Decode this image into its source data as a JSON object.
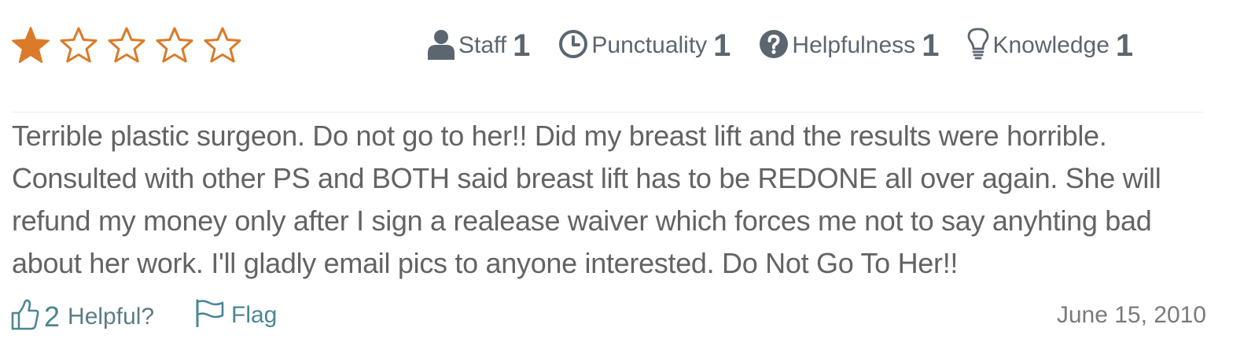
{
  "review": {
    "star_rating": 1,
    "star_max": 5,
    "colors": {
      "star": "#db7a28",
      "icon": "#5b6670",
      "accent": "#4a8792"
    },
    "ratings": [
      {
        "icon": "person-icon",
        "label": "Staff",
        "value": "1"
      },
      {
        "icon": "clock-icon",
        "label": "Punctuality",
        "value": "1"
      },
      {
        "icon": "question-circle-icon",
        "label": "Helpfulness",
        "value": "1"
      },
      {
        "icon": "lightbulb-icon",
        "label": "Knowledge",
        "value": "1"
      }
    ],
    "text": "Terrible plastic surgeon. Do not go to her!! Did my breast lift and the results were horrible. Consulted with other PS and BOTH said breast lift has to be REDONE all over again. She will refund my money only after I sign a realease waiver which forces me not to say anyhting bad about her work. I'll gladly email pics to anyone interested. Do Not Go To Her!!",
    "helpful_count": "2",
    "helpful_label": "Helpful?",
    "flag_label": "Flag",
    "date": "June 15, 2010"
  }
}
